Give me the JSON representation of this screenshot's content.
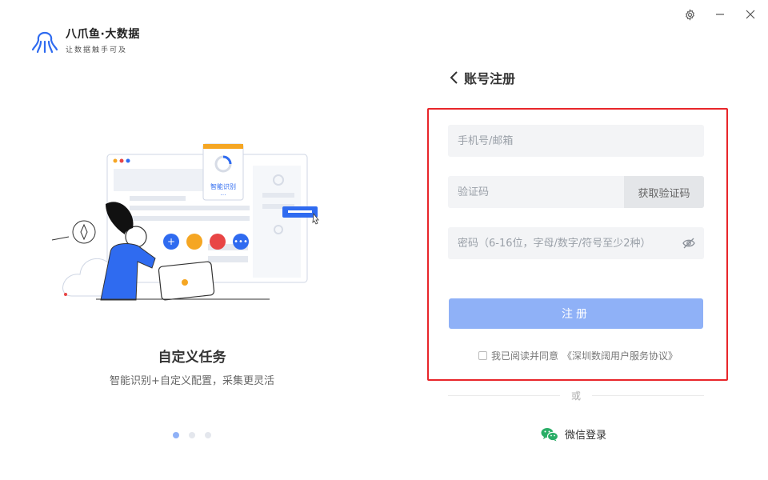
{
  "window": {
    "settings_icon": "gear-icon",
    "minimize_icon": "minimize-icon",
    "close_icon": "close-icon"
  },
  "brand": {
    "name": "八爪鱼·大数据",
    "slogan": "让数据触手可及",
    "logo_icon": "octopus-logo-icon",
    "color": "#2f6bf0"
  },
  "carousel": {
    "title": "自定义任务",
    "description": "智能识别+自定义配置，采集更灵活",
    "illustration_label": "智能识别",
    "active_index": 0,
    "dot_count": 3
  },
  "register": {
    "back_label": "账号注册",
    "phone_placeholder": "手机号/邮箱",
    "code_placeholder": "验证码",
    "get_code_label": "获取验证码",
    "password_placeholder": "密码（6-16位，字母/数字/符号至少2种）",
    "submit_label": "注册",
    "agreement_prefix": "我已阅读并同意",
    "agreement_link": "《深圳数阔用户服务协议》",
    "or_label": "或",
    "wechat_label": "微信登录"
  },
  "colors": {
    "accent": "#8fb1f7",
    "highlight_border": "#e8262a",
    "wechat": "#2aae67"
  }
}
